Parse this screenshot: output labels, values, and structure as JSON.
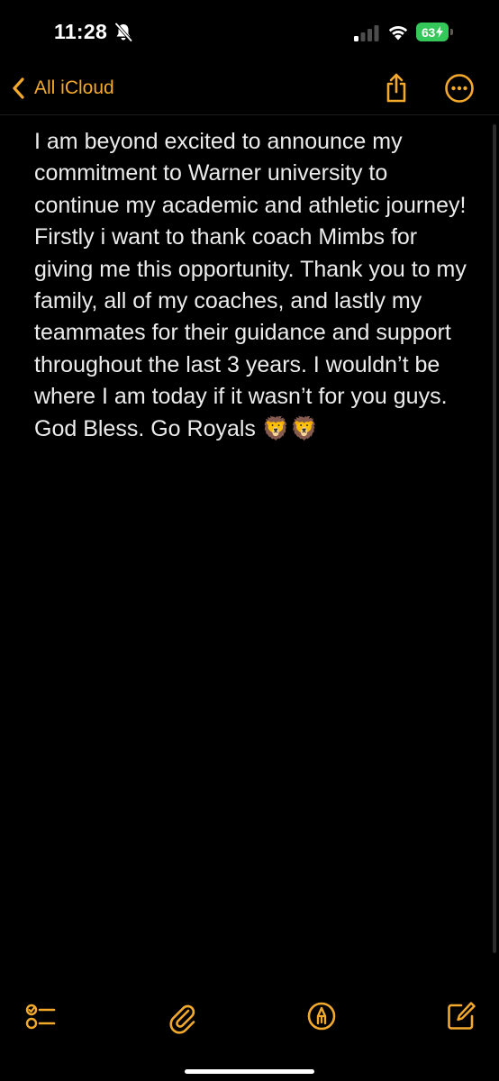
{
  "status_bar": {
    "time": "11:28",
    "battery_level": "63",
    "icons": [
      "bell-slash-icon",
      "signal-icon",
      "wifi-icon",
      "battery-charging-icon"
    ]
  },
  "nav": {
    "back_label": "All iCloud",
    "icons": [
      "chevron-left-icon",
      "share-icon",
      "more-icon"
    ]
  },
  "note": {
    "text": "I am beyond excited to announce my commitment to Warner university to continue my academic and athletic journey! Firstly i want to thank coach Mimbs for giving me this opportunity. Thank you to my family, all of my coaches, and lastly my teammates for their guidance and support throughout the last 3 years. I wouldn’t be where I am today if it wasn’t for you guys. God Bless. Go Royals 🦁🦁"
  },
  "toolbar": {
    "icons": [
      "checklist-icon",
      "paperclip-icon",
      "markup-icon",
      "compose-icon"
    ]
  },
  "colors": {
    "accent": "#f2a92c",
    "background": "#000000",
    "text": "#ececec",
    "battery": "#34c759"
  }
}
